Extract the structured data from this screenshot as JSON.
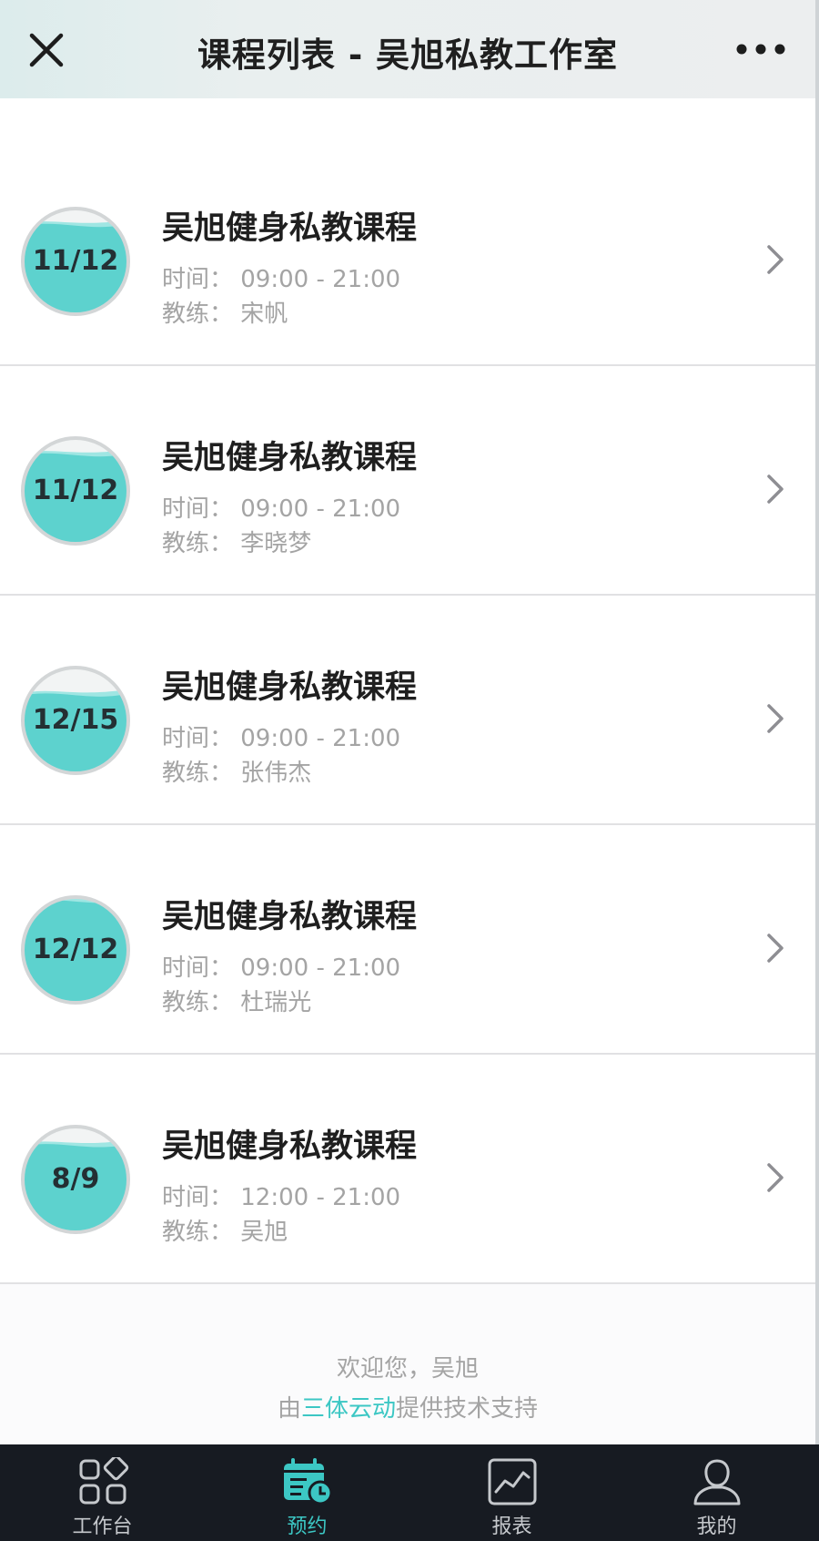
{
  "header": {
    "title": "课程列表 - 吴旭私教工作室",
    "close_icon": "close-icon",
    "more_icon": "more-dots-icon"
  },
  "courses": [
    {
      "badge": "11/12",
      "fill": 0.88,
      "title": "吴旭健身私教课程",
      "time": "时间：  09:00 - 21:00",
      "coach": "教练：  宋帆"
    },
    {
      "badge": "11/12",
      "fill": 0.88,
      "title": "吴旭健身私教课程",
      "time": "时间：  09:00 - 21:00",
      "coach": "教练：  李晓梦"
    },
    {
      "badge": "12/15",
      "fill": 0.78,
      "title": "吴旭健身私教课程",
      "time": "时间：  09:00 - 21:00",
      "coach": "教练：  张伟杰"
    },
    {
      "badge": "12/12",
      "fill": 1.0,
      "title": "吴旭健身私教课程",
      "time": "时间：  09:00 - 21:00",
      "coach": "教练：  杜瑞光"
    },
    {
      "badge": "8/9",
      "fill": 0.86,
      "title": "吴旭健身私教课程",
      "time": "时间：  12:00 - 21:00",
      "coach": "教练：  吴旭"
    }
  ],
  "footer": {
    "welcome": "欢迎您，吴旭",
    "support_prefix": "由",
    "support_brand": "三体云动",
    "support_suffix": "提供技术支持"
  },
  "tabs": [
    {
      "label": "工作台",
      "icon": "workbench-grid-icon",
      "active": false
    },
    {
      "label": "预约",
      "icon": "calendar-clock-icon",
      "active": true
    },
    {
      "label": "报表",
      "icon": "chart-line-icon",
      "active": false
    },
    {
      "label": "我的",
      "icon": "person-icon",
      "active": false
    }
  ],
  "colors": {
    "accent": "#3cc7c4",
    "badge_fill": "#5dd2ce",
    "badge_water_light": "#9fe6e3",
    "tabbar_bg": "#171b22"
  }
}
